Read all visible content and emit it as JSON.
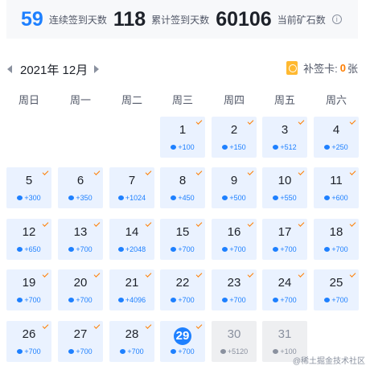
{
  "stats": [
    {
      "value": "59",
      "label": "连续签到天数",
      "color": "blue"
    },
    {
      "value": "118",
      "label": "累计签到天数",
      "color": "dark"
    },
    {
      "value": "60106",
      "label": "当前矿石数",
      "color": "dark"
    }
  ],
  "info_icon": "info-icon",
  "month": {
    "label": "2021年 12月",
    "prev_icon": "chevron-left-icon",
    "next_icon": "chevron-right-icon"
  },
  "makeup": {
    "label": "补签卡:",
    "count": "0",
    "unit": "张",
    "icon": "makeup-card-icon"
  },
  "weekdays": [
    "周日",
    "周一",
    "周二",
    "周三",
    "周四",
    "周五",
    "周六"
  ],
  "days": [
    {
      "day": "1",
      "reward": "+100",
      "checked": true,
      "state": "past"
    },
    {
      "day": "2",
      "reward": "+150",
      "checked": true,
      "state": "past"
    },
    {
      "day": "3",
      "reward": "+512",
      "checked": true,
      "state": "past"
    },
    {
      "day": "4",
      "reward": "+250",
      "checked": true,
      "state": "past"
    },
    {
      "day": "5",
      "reward": "+300",
      "checked": true,
      "state": "past"
    },
    {
      "day": "6",
      "reward": "+350",
      "checked": true,
      "state": "past"
    },
    {
      "day": "7",
      "reward": "+1024",
      "checked": true,
      "state": "past"
    },
    {
      "day": "8",
      "reward": "+450",
      "checked": true,
      "state": "past"
    },
    {
      "day": "9",
      "reward": "+500",
      "checked": true,
      "state": "past"
    },
    {
      "day": "10",
      "reward": "+550",
      "checked": true,
      "state": "past"
    },
    {
      "day": "11",
      "reward": "+600",
      "checked": true,
      "state": "past"
    },
    {
      "day": "12",
      "reward": "+650",
      "checked": true,
      "state": "past"
    },
    {
      "day": "13",
      "reward": "+700",
      "checked": true,
      "state": "past"
    },
    {
      "day": "14",
      "reward": "+2048",
      "checked": true,
      "state": "past"
    },
    {
      "day": "15",
      "reward": "+700",
      "checked": true,
      "state": "past"
    },
    {
      "day": "16",
      "reward": "+700",
      "checked": true,
      "state": "past"
    },
    {
      "day": "17",
      "reward": "+700",
      "checked": true,
      "state": "past"
    },
    {
      "day": "18",
      "reward": "+700",
      "checked": true,
      "state": "past"
    },
    {
      "day": "19",
      "reward": "+700",
      "checked": true,
      "state": "past"
    },
    {
      "day": "20",
      "reward": "+700",
      "checked": true,
      "state": "past"
    },
    {
      "day": "21",
      "reward": "+4096",
      "checked": true,
      "state": "past"
    },
    {
      "day": "22",
      "reward": "+700",
      "checked": true,
      "state": "past"
    },
    {
      "day": "23",
      "reward": "+700",
      "checked": true,
      "state": "past"
    },
    {
      "day": "24",
      "reward": "+700",
      "checked": true,
      "state": "past"
    },
    {
      "day": "25",
      "reward": "+700",
      "checked": true,
      "state": "past"
    },
    {
      "day": "26",
      "reward": "+700",
      "checked": true,
      "state": "past"
    },
    {
      "day": "27",
      "reward": "+700",
      "checked": true,
      "state": "past"
    },
    {
      "day": "28",
      "reward": "+700",
      "checked": true,
      "state": "past"
    },
    {
      "day": "29",
      "reward": "+700",
      "checked": true,
      "state": "today"
    },
    {
      "day": "30",
      "reward": "+5120",
      "checked": false,
      "state": "future"
    },
    {
      "day": "31",
      "reward": "+100",
      "checked": false,
      "state": "future"
    }
  ],
  "first_weekday_index": 3,
  "colors": {
    "accent": "#1e80ff",
    "check": "#ff7d00",
    "future": "#eeeff1",
    "cell": "#eaf2ff"
  },
  "watermark": "@稀土掘金技术社区"
}
